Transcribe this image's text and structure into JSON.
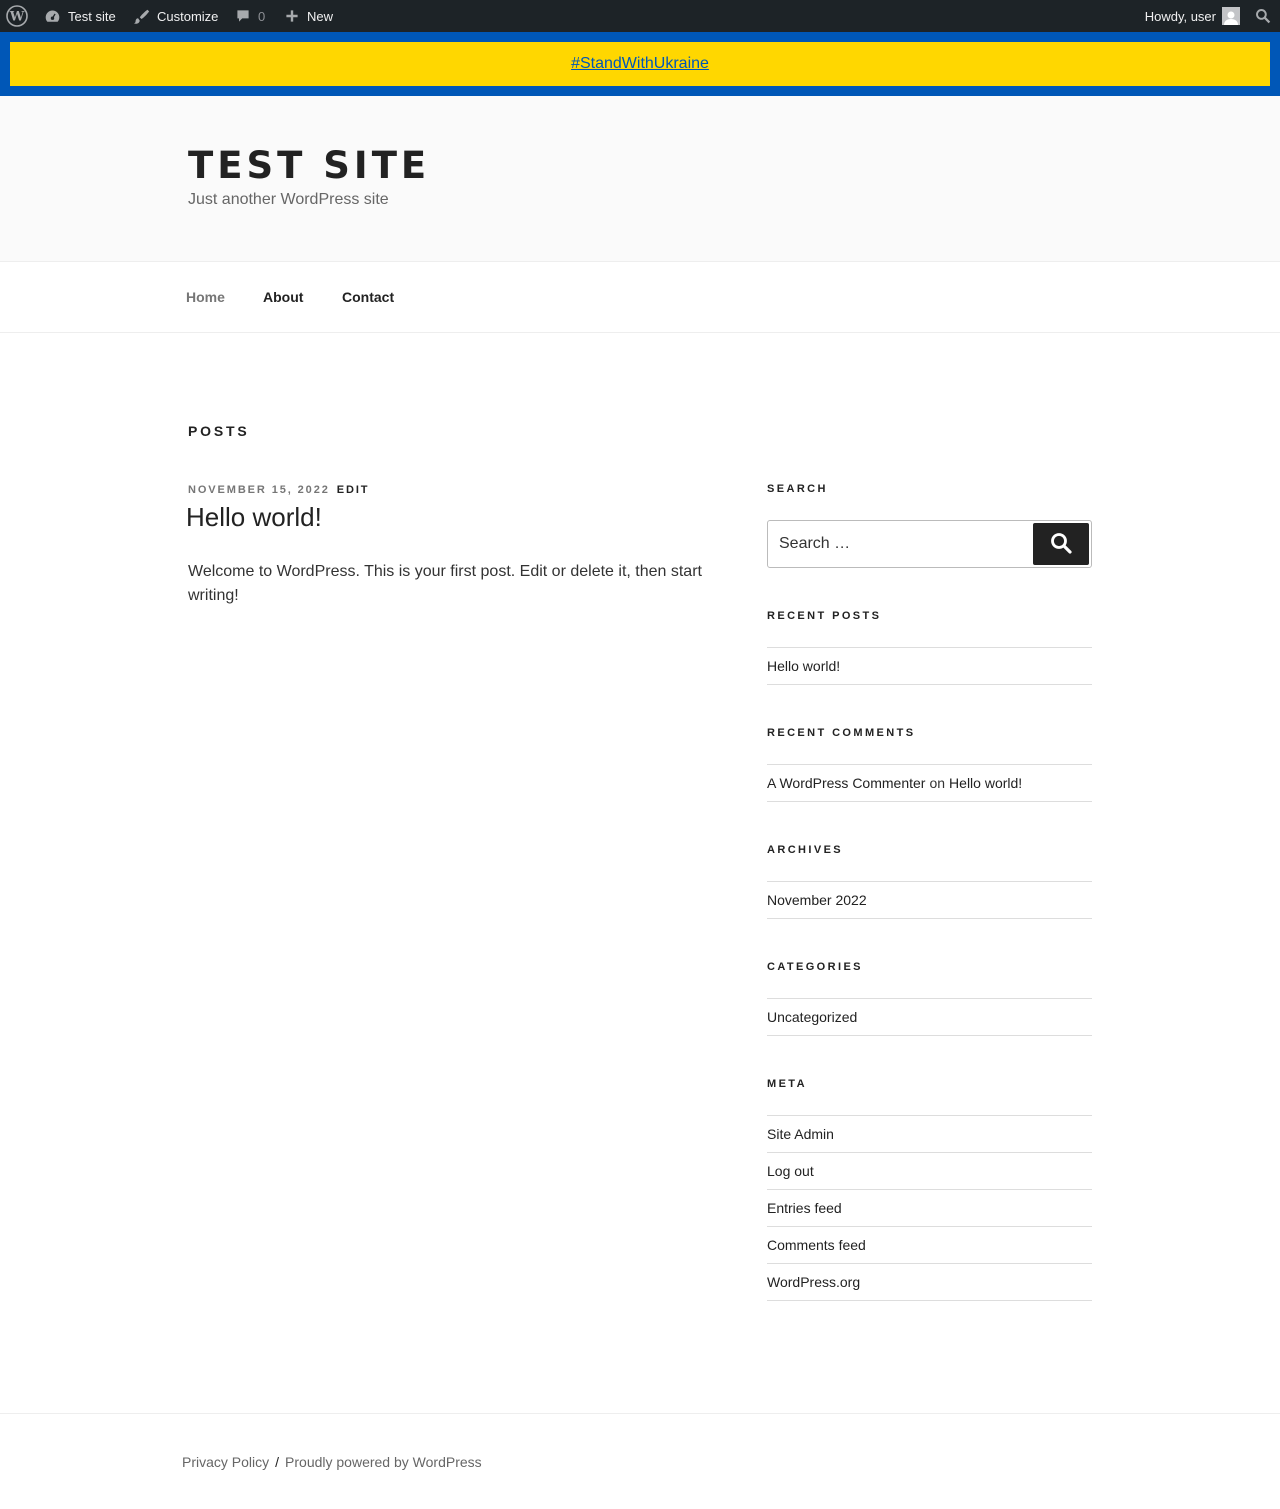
{
  "admin_bar": {
    "site_name": "Test site",
    "customize": "Customize",
    "comments_count": "0",
    "new": "New",
    "howdy": "Howdy, user"
  },
  "banner": {
    "link": "#StandWithUkraine"
  },
  "header": {
    "title": "Test site",
    "description": "Just another WordPress site"
  },
  "nav": {
    "items": [
      {
        "label": "Home"
      },
      {
        "label": "About"
      },
      {
        "label": "Contact"
      }
    ]
  },
  "main": {
    "page_title": "Posts",
    "post": {
      "date": "November 15, 2022",
      "edit": "Edit",
      "title": "Hello world!",
      "excerpt": "Welcome to WordPress. This is your first post. Edit or delete it, then start writing!"
    }
  },
  "sidebar": {
    "search": {
      "title": "Search",
      "placeholder": "Search …"
    },
    "recent_posts": {
      "title": "Recent Posts",
      "items": [
        "Hello world!"
      ]
    },
    "recent_comments": {
      "title": "Recent Comments",
      "author": "A WordPress Commenter",
      "on": "on",
      "post": "Hello world!"
    },
    "archives": {
      "title": "Archives",
      "items": [
        "November 2022"
      ]
    },
    "categories": {
      "title": "Categories",
      "items": [
        "Uncategorized"
      ]
    },
    "meta": {
      "title": "Meta",
      "items": [
        "Site Admin",
        "Log out",
        "Entries feed",
        "Comments feed",
        "WordPress.org"
      ]
    }
  },
  "footer": {
    "privacy": "Privacy Policy",
    "separator": "/",
    "powered": "Proudly powered by WordPress"
  },
  "colors": {
    "admin_bar": "#1d2327",
    "ukraine_blue": "#0057b7",
    "ukraine_yellow": "#ffd700",
    "header_bg": "#fafafa"
  }
}
